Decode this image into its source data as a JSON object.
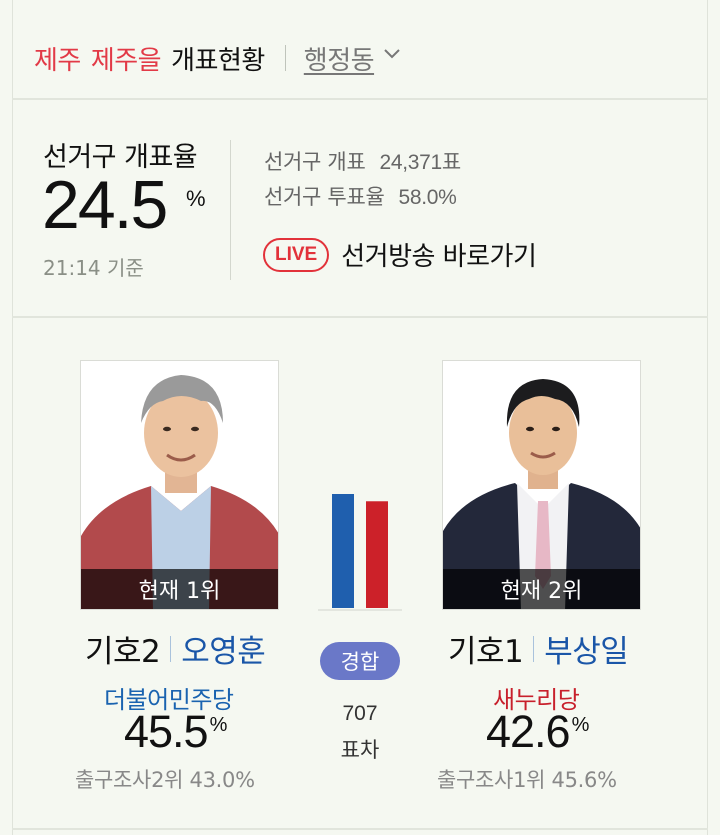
{
  "header": {
    "region1": "제주",
    "region2": "제주을",
    "title": "개표현황",
    "dong_label": "행정동"
  },
  "summary": {
    "rate_label": "선거구 개표율",
    "rate_value": "24.5",
    "rate_unit": "%",
    "time": "21:14 기준",
    "count_label": "선거구 개표",
    "count_value": "24,371표",
    "turnout_label": "선거구 투표율",
    "turnout_value": "58.0%",
    "live_badge": "LIVE",
    "live_text": "선거방송 바로가기"
  },
  "race": {
    "status": "경합",
    "diff": "707",
    "diff_unit": "표차",
    "bar_colors": [
      "#1f5fae",
      "#cc2129"
    ],
    "bar_ratio": [
      45.5,
      42.6
    ]
  },
  "candidates": [
    {
      "rank": "현재 1위",
      "ballot_no": "기호2",
      "name": "오영훈",
      "party": "더불어민주당",
      "party_color": "#1a63b0",
      "percent": "45.5",
      "unit": "%",
      "exit_poll": "출구조사2위 43.0%"
    },
    {
      "rank": "현재 2위",
      "ballot_no": "기호1",
      "name": "부상일",
      "party": "새누리당",
      "party_color": "#c8202c",
      "percent": "42.6",
      "unit": "%",
      "exit_poll": "출구조사1위 45.6%"
    }
  ]
}
